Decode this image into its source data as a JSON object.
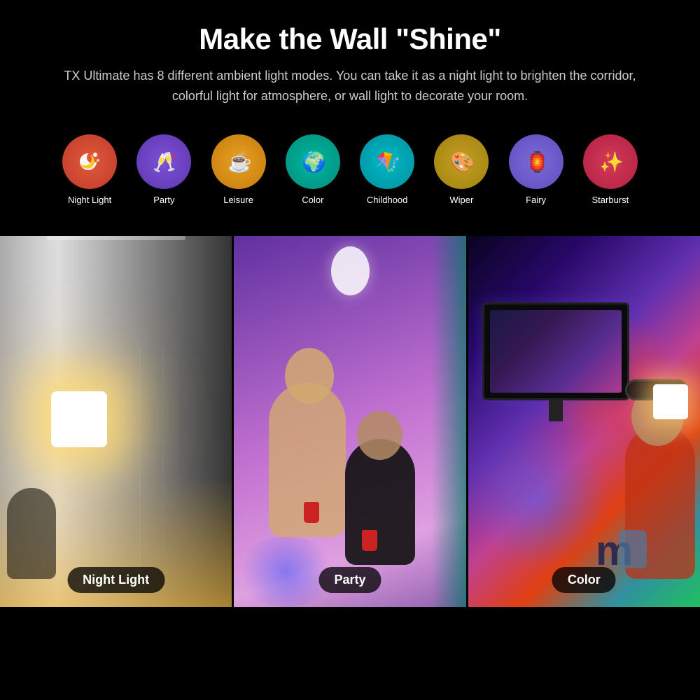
{
  "header": {
    "title": "Make the Wall \"Shine\"",
    "subtitle": "TX Ultimate has 8 different ambient light modes. You can take it as a night light to brighten the corridor, colorful light for atmosphere, or wall light to decorate your room."
  },
  "modes": [
    {
      "id": "night-light",
      "label": "Night Light",
      "icon": "🌙",
      "iconClass": "icon-night",
      "emoji": "🌙"
    },
    {
      "id": "party",
      "label": "Party",
      "icon": "🥂",
      "iconClass": "icon-party",
      "emoji": "🥂"
    },
    {
      "id": "leisure",
      "label": "Leisure",
      "icon": "☕",
      "iconClass": "icon-leisure",
      "emoji": "☕"
    },
    {
      "id": "color",
      "label": "Color",
      "icon": "🌍",
      "iconClass": "icon-color",
      "emoji": "🌍"
    },
    {
      "id": "childhood",
      "label": "Childhood",
      "icon": "🪁",
      "iconClass": "icon-childhood",
      "emoji": "🪁"
    },
    {
      "id": "wiper",
      "label": "Wiper",
      "icon": "🎨",
      "iconClass": "icon-wiper",
      "emoji": "🎨"
    },
    {
      "id": "fairy",
      "label": "Fairy",
      "icon": "🏮",
      "iconClass": "icon-fairy",
      "emoji": "🏮"
    },
    {
      "id": "starburst",
      "label": "Starburst",
      "icon": "✨",
      "iconClass": "icon-starburst",
      "emoji": "✨"
    }
  ],
  "photos": [
    {
      "id": "night-light",
      "label": "Night Light"
    },
    {
      "id": "party",
      "label": "Party"
    },
    {
      "id": "color",
      "label": "Color"
    }
  ]
}
